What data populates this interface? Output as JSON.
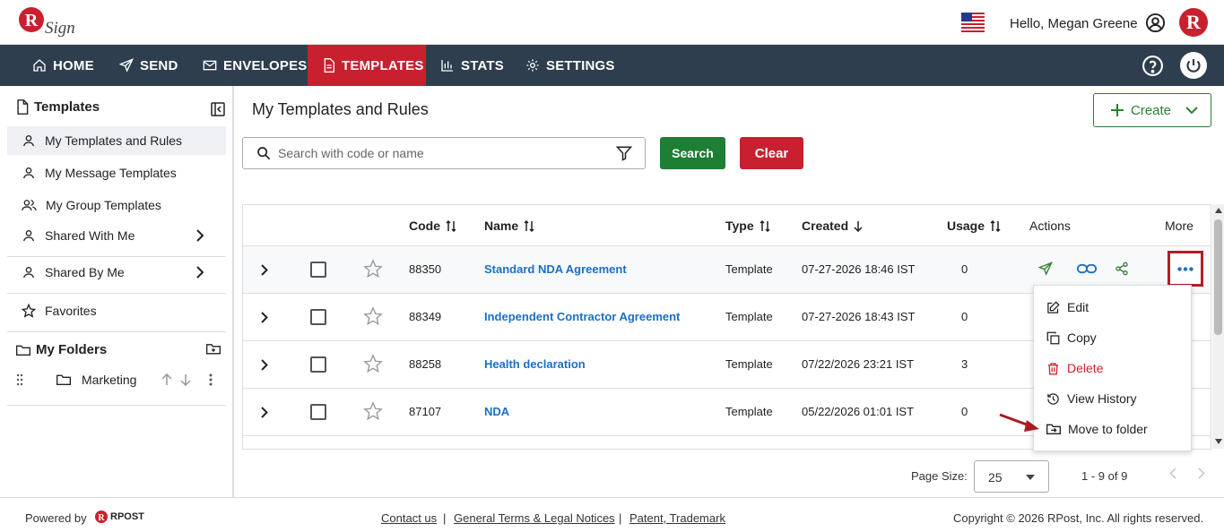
{
  "header": {
    "logo_text": "RSign",
    "greeting": "Hello, Megan Greene",
    "avatar_letter": "R"
  },
  "nav": {
    "items": [
      "HOME",
      "SEND",
      "ENVELOPES",
      "TEMPLATES",
      "STATS",
      "SETTINGS"
    ],
    "active": "TEMPLATES"
  },
  "sidebar": {
    "title": "Templates",
    "items": [
      "My Templates and Rules",
      "My Message Templates",
      "My Group Templates",
      "Shared With Me",
      "Shared By Me",
      "Favorites"
    ],
    "folders_title": "My Folders",
    "folders": [
      "Marketing"
    ]
  },
  "main": {
    "title": "My Templates and Rules",
    "create_label": "Create",
    "search_placeholder": "Search with code or name",
    "search_label": "Search",
    "clear_label": "Clear"
  },
  "table": {
    "headers": [
      "Code",
      "Name",
      "Type",
      "Created",
      "Usage",
      "Actions",
      "More"
    ],
    "rows": [
      {
        "code": "88350",
        "name": "Standard NDA Agreement",
        "type": "Template",
        "created": "07-27-2026 18:46 IST",
        "usage": "0"
      },
      {
        "code": "88349",
        "name": "Independent Contractor Agreement",
        "type": "Template",
        "created": "07-27-2026 18:43 IST",
        "usage": "0"
      },
      {
        "code": "88258",
        "name": "Health declaration",
        "type": "Template",
        "created": "07/22/2026 23:21 IST",
        "usage": "3"
      },
      {
        "code": "87107",
        "name": "NDA",
        "type": "Template",
        "created": "05/22/2026 01:01 IST",
        "usage": "0"
      }
    ]
  },
  "menu": {
    "items": [
      "Edit",
      "Copy",
      "Delete",
      "View History",
      "Move to folder"
    ]
  },
  "pager": {
    "page_size_label": "Page Size:",
    "page_size": "25",
    "range": "1 - 9 of 9"
  },
  "footer": {
    "powered_by": "Powered by",
    "brand": "RPOST",
    "links": [
      "Contact us",
      "General Terms & Legal Notices",
      "Patent, Trademark"
    ],
    "separator": "|",
    "copyright": "Copyright © 2026 RPost, Inc. All rights reserved."
  },
  "colors": {
    "brand_red": "#c8202f",
    "nav_bg": "#2e3e4e",
    "green": "#1e7e34",
    "link_blue": "#1a6fc7"
  }
}
